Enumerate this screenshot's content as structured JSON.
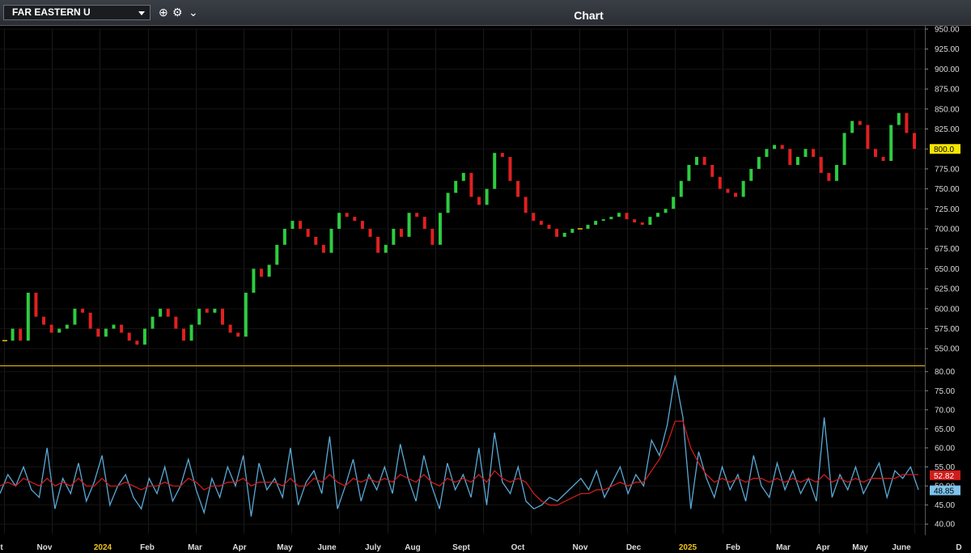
{
  "toolbar": {
    "symbol": "FAR EASTERN U",
    "title": "Chart",
    "icons": [
      "add-circle-icon",
      "gear-icon",
      "chevron-down-icon"
    ]
  },
  "colors": {
    "background": "#000000",
    "up": "#2ecc40",
    "down": "#e02020",
    "flat": "#f0c419",
    "rsi": "#5aa9d6",
    "rsi_ma": "#d01c1c",
    "last_price_badge": "#f7e600"
  },
  "chart_data": [
    {
      "type": "line",
      "subtype": "ohlc-bars",
      "series": [
        {
          "name": "Price",
          "values": [
            560,
            575,
            560,
            620,
            590,
            580,
            570,
            575,
            580,
            600,
            595,
            575,
            565,
            575,
            580,
            570,
            560,
            555,
            575,
            590,
            600,
            590,
            575,
            560,
            580,
            600,
            595,
            600,
            580,
            570,
            565,
            620,
            650,
            640,
            655,
            680,
            700,
            710,
            700,
            690,
            680,
            670,
            700,
            720,
            715,
            710,
            700,
            690,
            670,
            680,
            700,
            690,
            720,
            715,
            700,
            680,
            720,
            745,
            760,
            770,
            740,
            730,
            750,
            795,
            790,
            760,
            740,
            720,
            710,
            705,
            700,
            690,
            695,
            700,
            700,
            705,
            710,
            712,
            715,
            720,
            712,
            708,
            705,
            715,
            720,
            725,
            740,
            760,
            780,
            790,
            780,
            765,
            750,
            745,
            740,
            760,
            775,
            790,
            800,
            805,
            800,
            780,
            790,
            800,
            790,
            770,
            760,
            780,
            820,
            835,
            830,
            800,
            790,
            785,
            830,
            845,
            820,
            800
          ]
        }
      ],
      "ylim": [
        530,
        950
      ],
      "yticks": [
        550,
        575,
        600,
        625,
        650,
        675,
        700,
        725,
        750,
        775,
        800,
        825,
        850,
        875,
        900,
        925,
        950
      ],
      "last_price": "800.0"
    },
    {
      "type": "line",
      "series": [
        {
          "name": "RSI",
          "values": [
            48,
            53,
            50,
            55,
            49,
            47,
            60,
            44,
            52,
            48,
            56,
            46,
            51,
            58,
            45,
            50,
            53,
            47,
            44,
            52,
            48,
            55,
            46,
            50,
            57,
            49,
            43,
            52,
            47,
            55,
            50,
            58,
            42,
            56,
            49,
            52,
            47,
            60,
            45,
            51,
            54,
            48,
            63,
            44,
            50,
            57,
            46,
            53,
            49,
            55,
            48,
            61,
            52,
            46,
            58,
            50,
            44,
            56,
            49,
            53,
            47,
            60,
            45,
            64,
            51,
            48,
            55,
            46,
            44,
            45,
            47,
            46,
            48,
            50,
            52,
            49,
            54,
            47,
            51,
            55,
            48,
            53,
            50,
            62,
            58,
            66,
            79,
            68,
            44,
            59,
            52,
            47,
            55,
            49,
            53,
            46,
            58,
            50,
            47,
            56,
            49,
            54,
            48,
            52,
            46,
            68,
            47,
            53,
            49,
            55,
            48,
            52,
            56,
            47,
            54,
            52,
            55,
            49
          ]
        },
        {
          "name": "RSI MA",
          "values": [
            50,
            51,
            50,
            52,
            51,
            50,
            52,
            50,
            51,
            50,
            52,
            50,
            50,
            52,
            50,
            50,
            51,
            50,
            49,
            50,
            50,
            51,
            50,
            50,
            52,
            51,
            49,
            50,
            50,
            51,
            51,
            52,
            50,
            51,
            51,
            51,
            50,
            52,
            50,
            50,
            52,
            51,
            53,
            51,
            50,
            52,
            51,
            52,
            51,
            52,
            51,
            53,
            52,
            51,
            53,
            51,
            50,
            52,
            51,
            52,
            51,
            53,
            51,
            54,
            52,
            51,
            52,
            51,
            48,
            46,
            45,
            45,
            46,
            47,
            48,
            48,
            49,
            49,
            50,
            51,
            50,
            51,
            51,
            54,
            57,
            61,
            67,
            67,
            60,
            56,
            53,
            51,
            52,
            51,
            52,
            51,
            52,
            52,
            51,
            52,
            51,
            52,
            51,
            52,
            51,
            53,
            51,
            52,
            51,
            52,
            51,
            52,
            52,
            52,
            52,
            53,
            53,
            53
          ]
        }
      ],
      "ylim": [
        37.5,
        81
      ],
      "yticks": [
        40,
        45,
        50,
        55,
        60,
        65,
        70,
        75,
        80
      ],
      "last_values": [
        "52.82",
        "48.85"
      ]
    }
  ],
  "x_axis": {
    "labels": [
      {
        "text": "t",
        "kind": "month"
      },
      {
        "text": "Nov",
        "kind": "month"
      },
      {
        "text": "2024",
        "kind": "year"
      },
      {
        "text": "Feb",
        "kind": "month"
      },
      {
        "text": "Mar",
        "kind": "month"
      },
      {
        "text": "Apr",
        "kind": "month"
      },
      {
        "text": "May",
        "kind": "month"
      },
      {
        "text": "June",
        "kind": "month"
      },
      {
        "text": "July",
        "kind": "month"
      },
      {
        "text": "Aug",
        "kind": "month"
      },
      {
        "text": "Sept",
        "kind": "month"
      },
      {
        "text": "Oct",
        "kind": "month"
      },
      {
        "text": "Nov",
        "kind": "month"
      },
      {
        "text": "Dec",
        "kind": "month"
      },
      {
        "text": "2025",
        "kind": "year"
      },
      {
        "text": "Feb",
        "kind": "month"
      },
      {
        "text": "Mar",
        "kind": "month"
      },
      {
        "text": "Apr",
        "kind": "month"
      },
      {
        "text": "May",
        "kind": "month"
      },
      {
        "text": "June",
        "kind": "month"
      },
      {
        "text": "D",
        "kind": "month"
      }
    ]
  }
}
